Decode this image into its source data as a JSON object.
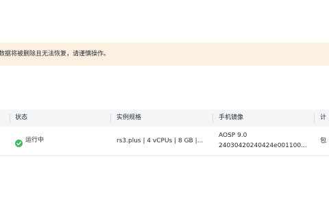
{
  "banner": {
    "warning_text": "数据将被删除且无法恢复，请谨慎操作。"
  },
  "table": {
    "columns": [
      "状态",
      "实例规格",
      "手机镜像",
      "计"
    ],
    "rows": [
      {
        "status": "运行中",
        "spec": "rs3.plus | 4 vCPUs | 8 GB |...",
        "image_name": "AOSP 9.0",
        "image_id": "24030420240424e001100...",
        "billing": "包"
      }
    ]
  },
  "colors": {
    "banner_bg": "#fdf0e0",
    "header_bg": "#f4f5f6",
    "status_running": "#3fba62"
  },
  "icons": {
    "status": "check-circle-icon"
  }
}
